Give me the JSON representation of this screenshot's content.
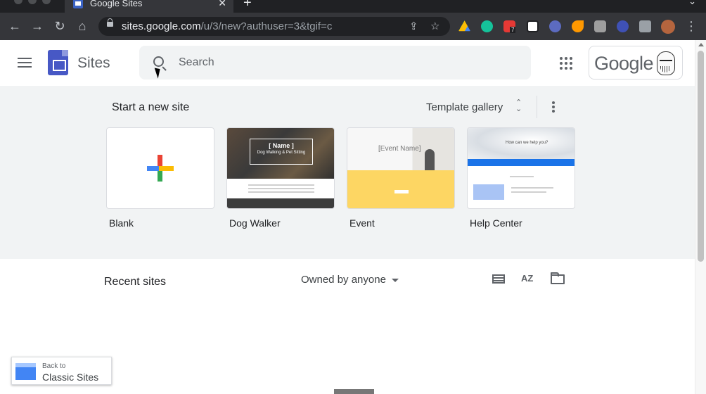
{
  "browser": {
    "tab_title": "Google Sites",
    "tab_close": "✕",
    "new_tab": "+",
    "url_host": "sites.google.com",
    "url_path": "/u/3/new?authuser=3&tgif=c",
    "extension_badge": "7"
  },
  "header": {
    "app_name": "Sites",
    "search_placeholder": "Search",
    "account_logo_text": "Google"
  },
  "templates": {
    "section_title": "Start a new site",
    "gallery_label": "Template gallery",
    "cards": [
      {
        "label": "Blank"
      },
      {
        "label": "Dog Walker",
        "thumb_title": "[ Name ]",
        "thumb_subtitle": "Dog Walking & Pet Sitting"
      },
      {
        "label": "Event",
        "thumb_title": "[Event Name]"
      },
      {
        "label": "Help Center",
        "thumb_title": "How can we help you?"
      }
    ]
  },
  "recent": {
    "title": "Recent sites",
    "owner_filter": "Owned by anyone",
    "sort_label": "AZ"
  },
  "classic": {
    "small_label": "Back to",
    "big_label": "Classic Sites"
  },
  "colors": {
    "sites_purple": "#4758c5",
    "google_blue": "#4285f4",
    "event_yellow": "#fdd663",
    "help_blue": "#1a73e8"
  }
}
